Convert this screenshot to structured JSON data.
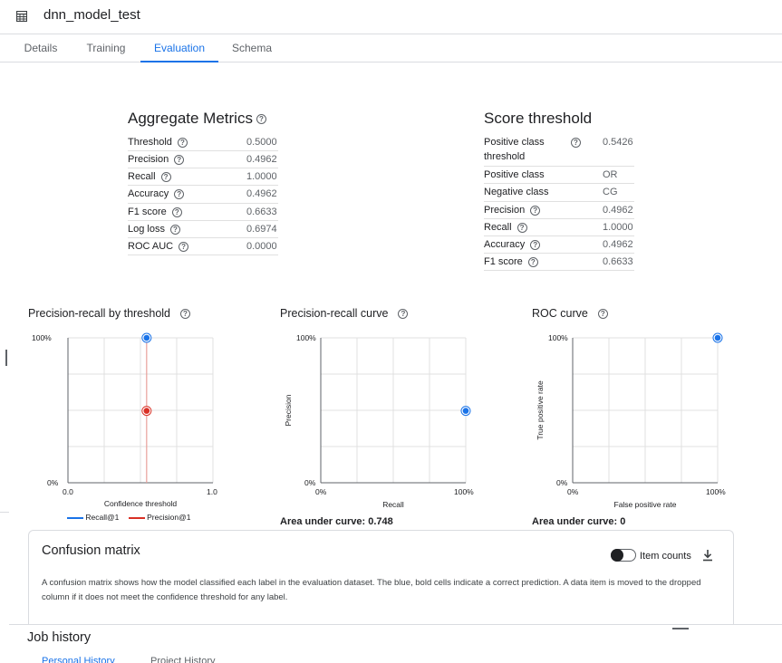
{
  "header": {
    "title": "dnn_model_test",
    "icon": "table-icon"
  },
  "tabs": [
    {
      "label": "Details",
      "active": false
    },
    {
      "label": "Training",
      "active": false
    },
    {
      "label": "Evaluation",
      "active": true
    },
    {
      "label": "Schema",
      "active": false
    }
  ],
  "aggregate": {
    "title": "Aggregate Metrics",
    "rows": [
      {
        "label": "Threshold",
        "value": "0.5000",
        "help": true
      },
      {
        "label": "Precision",
        "value": "0.4962",
        "help": true
      },
      {
        "label": "Recall",
        "value": "1.0000",
        "help": true
      },
      {
        "label": "Accuracy",
        "value": "0.4962",
        "help": true
      },
      {
        "label": "F1 score",
        "value": "0.6633",
        "help": true
      },
      {
        "label": "Log loss",
        "value": "0.6974",
        "help": true
      },
      {
        "label": "ROC AUC",
        "value": "0.0000",
        "help": true
      }
    ]
  },
  "score": {
    "title": "Score threshold",
    "rows": [
      {
        "label": "Positive class threshold",
        "value": "0.5426",
        "help": true
      },
      {
        "label": "Positive class",
        "value": "OR",
        "help": false
      },
      {
        "label": "Negative class",
        "value": "CG",
        "help": false
      },
      {
        "label": "Precision",
        "value": "0.4962",
        "help": true
      },
      {
        "label": "Recall",
        "value": "1.0000",
        "help": true
      },
      {
        "label": "Accuracy",
        "value": "0.4962",
        "help": true
      },
      {
        "label": "F1 score",
        "value": "0.6633",
        "help": true
      }
    ]
  },
  "charts": {
    "pr_threshold": {
      "title": "Precision-recall by threshold",
      "y_top": "100%",
      "y_bottom": "0%",
      "x_left": "0.0",
      "x_right": "1.0",
      "xlabel": "Confidence threshold",
      "legend": [
        "Recall@1",
        "Precision@1"
      ]
    },
    "pr_curve": {
      "title": "Precision-recall curve",
      "y_top": "100%",
      "y_bottom": "0%",
      "x_left": "0%",
      "x_right": "100%",
      "xlabel": "Recall",
      "ylabel": "Precision",
      "auc_label": "Area under curve: 0.748"
    },
    "roc_curve": {
      "title": "ROC curve",
      "y_top": "100%",
      "y_bottom": "0%",
      "x_left": "0%",
      "x_right": "100%",
      "xlabel": "False positive rate",
      "ylabel": "True positive rate",
      "auc_label": "Area under curve: 0"
    }
  },
  "chart_data": [
    {
      "type": "scatter",
      "title": "Precision-recall by threshold",
      "xlabel": "Confidence threshold",
      "xlim": [
        0,
        1
      ],
      "ylim": [
        0,
        1
      ],
      "threshold": 0.5426,
      "series": [
        {
          "name": "Recall@1",
          "x": [
            0.5426
          ],
          "y": [
            1.0
          ],
          "color": "#1a73e8"
        },
        {
          "name": "Precision@1",
          "x": [
            0.5426
          ],
          "y": [
            0.4962
          ],
          "color": "#d93025"
        }
      ]
    },
    {
      "type": "scatter",
      "title": "Precision-recall curve",
      "xlabel": "Recall",
      "ylabel": "Precision",
      "xlim": [
        0,
        1
      ],
      "ylim": [
        0,
        1
      ],
      "series": [
        {
          "x": [
            1.0
          ],
          "y": [
            0.4962
          ],
          "color": "#1a73e8"
        }
      ]
    },
    {
      "type": "scatter",
      "title": "ROC curve",
      "xlabel": "False positive rate",
      "ylabel": "True positive rate",
      "xlim": [
        0,
        1
      ],
      "ylim": [
        0,
        1
      ],
      "series": [
        {
          "x": [
            1.0
          ],
          "y": [
            1.0
          ],
          "color": "#1a73e8"
        }
      ]
    }
  ],
  "confusion": {
    "title": "Confusion matrix",
    "toggle_label": "Item counts",
    "description": "A confusion matrix shows how the model classified each label in the evaluation dataset. The blue, bold cells indicate a correct prediction. A data item is moved to the dropped column if it does not meet the confidence threshold for any label."
  },
  "job_history": {
    "title": "Job history",
    "tabs": [
      "Personal History",
      "Project History"
    ]
  },
  "colors": {
    "accent": "#1a73e8",
    "precision": "#d93025",
    "recall": "#1a73e8"
  }
}
